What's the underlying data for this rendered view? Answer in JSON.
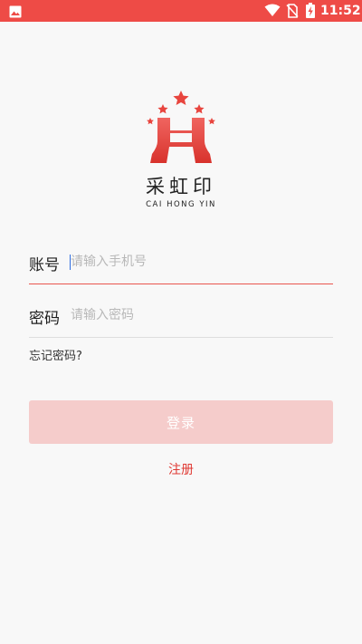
{
  "status_bar": {
    "time": "11:52",
    "icons": [
      "image-icon",
      "wifi-icon",
      "no-sim-icon",
      "battery-charging-icon"
    ],
    "background_color": "#ee4b46"
  },
  "brand": {
    "name_cn": "采虹印",
    "name_en": "CAI HONG YIN",
    "logo_icon": "h-stars-logo",
    "logo_color": "#e8453e"
  },
  "form": {
    "phone": {
      "label": "账号",
      "placeholder": "请输入手机号",
      "value": ""
    },
    "password": {
      "label": "密码",
      "placeholder": "请输入密码",
      "value": ""
    },
    "forgot_password": "忘记密码?",
    "login_button": "登录",
    "register_link": "注册"
  },
  "colors": {
    "accent": "#e03a34",
    "login_button_disabled": "#f5cccb",
    "background": "#f8f8f8"
  }
}
